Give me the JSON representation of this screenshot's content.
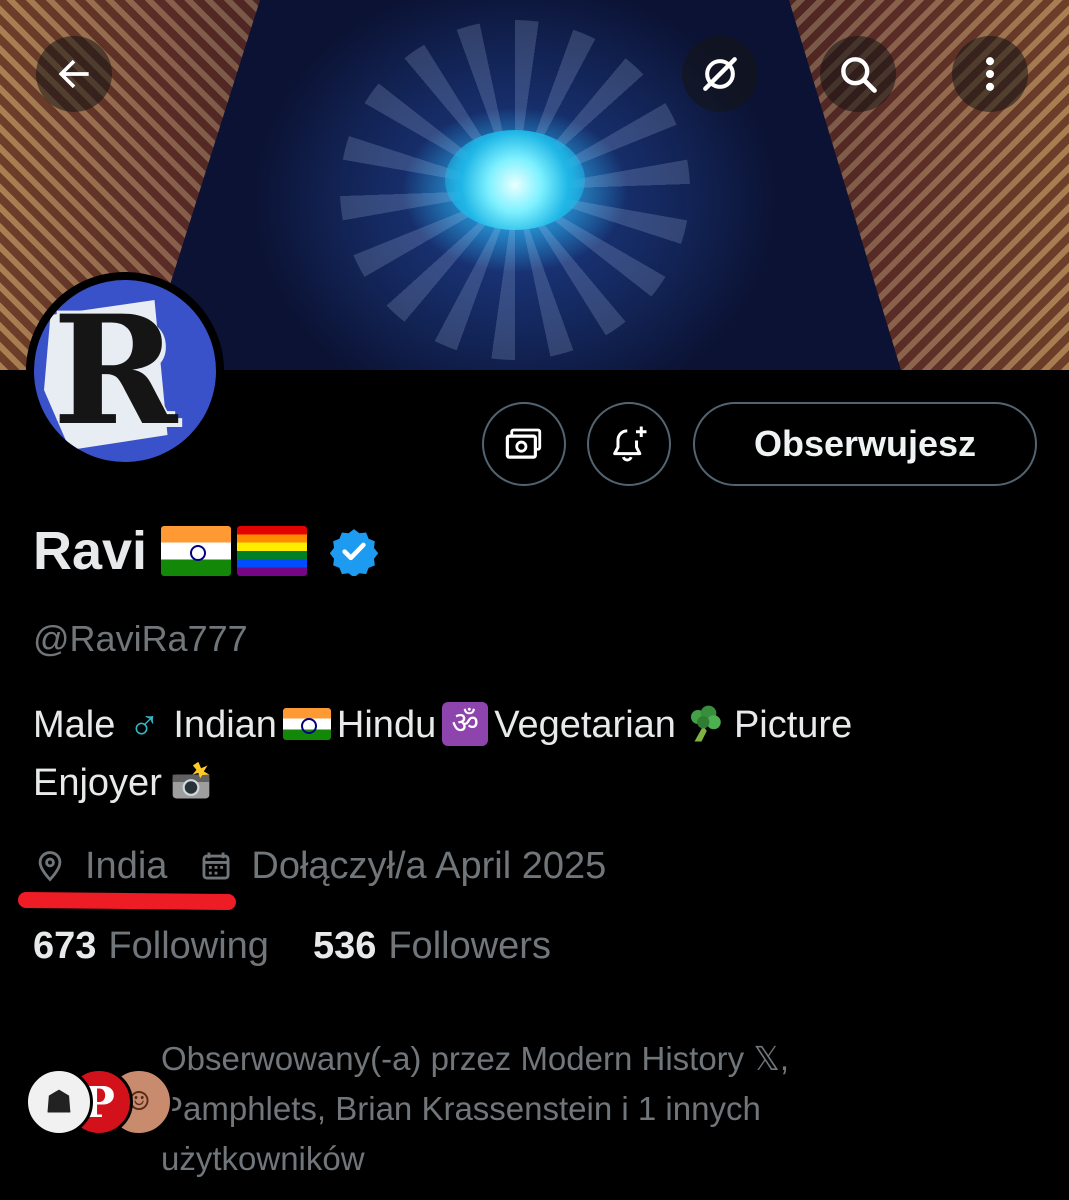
{
  "header": {
    "back_icon": "arrow-left-icon",
    "grok_icon": "grok-icon",
    "search_icon": "search-icon",
    "more_icon": "more-vertical-icon"
  },
  "profile": {
    "name": "Ravi",
    "name_emojis": [
      "flag-india",
      "rainbow-flag"
    ],
    "verified": true,
    "handle": "@RaviRa777",
    "bio": {
      "male": "Male",
      "indian": "Indian",
      "hindu": "Hindu",
      "vegetarian": "Vegetarian",
      "picture": "Picture",
      "enjoyer": "Enjoyer"
    },
    "location": "India",
    "joined": "Dołączył/a April 2025"
  },
  "actions": {
    "subscribe_icon": "money-icon",
    "notify_icon": "bell-plus-icon",
    "follow_label": "Obserwujesz"
  },
  "stats": {
    "following_count": "673",
    "following_label": "Following",
    "followers_count": "536",
    "followers_label": "Followers"
  },
  "followed_by": {
    "line1": "Obserwowany(-a) przez Modern History 𝕏,",
    "line2": "Pamphlets, Brian Krassenstein i 1 innych",
    "line3": "użytkowników"
  },
  "colors": {
    "background": "#000000",
    "text": "#e7e9ea",
    "muted": "#71767b",
    "border": "#536471",
    "verified": "#1d9bf0",
    "annotation_underline": "#ee1c25"
  }
}
